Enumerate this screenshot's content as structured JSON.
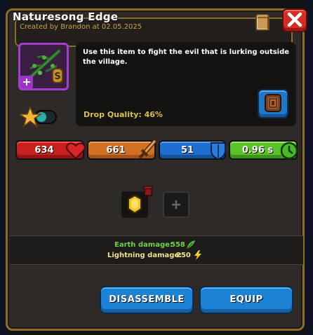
{
  "item": {
    "name": "Naturesong Edge",
    "created_by": "Created by Brandon at 02.05.2025",
    "description": "Use this item to fight the evil that is lurking outside the village.",
    "drop_quality": "Drop Quality: 46%"
  },
  "stats": {
    "health": "634",
    "attack": "661",
    "defense": "51",
    "speed": "0.96 s"
  },
  "damage": {
    "earth_label": "Earth damage:",
    "earth_value": "558",
    "lightning_label": "Lightning damage:",
    "lightning_value": "250"
  },
  "buttons": {
    "disassemble": "DISASSEMBLE",
    "equip": "EQUIP"
  },
  "colors": {
    "health": "#c81f1f",
    "attack": "#d07022",
    "defense": "#1f6fd0",
    "speed": "#5cc22a",
    "rarity": "#a33fd0",
    "earth_text": "#6fd04a",
    "lightning_text": "#f0e08a"
  }
}
